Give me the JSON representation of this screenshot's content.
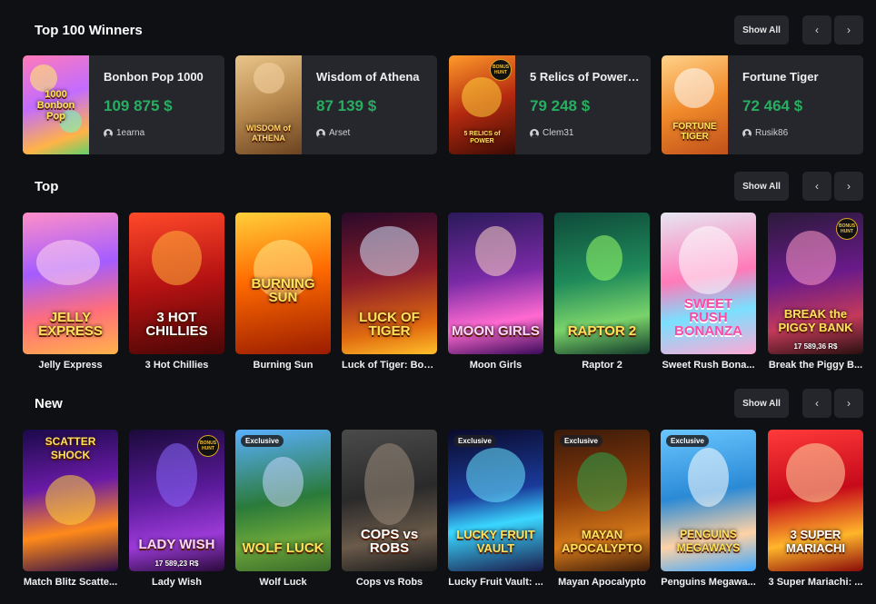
{
  "sections": {
    "winners": {
      "title": "Top 100 Winners",
      "show_all": "Show All"
    },
    "top": {
      "title": "Top",
      "show_all": "Show All"
    },
    "new": {
      "title": "New",
      "show_all": "Show All"
    }
  },
  "nav": {
    "prev_icon": "chevron-left-icon",
    "next_icon": "chevron-right-icon",
    "prev_glyph": "‹",
    "next_glyph": "›"
  },
  "winners": [
    {
      "game": "Bonbon Pop 1000",
      "amount": "109 875 $",
      "user": "1earna",
      "thumb_text": "1000 Bonbon Pop"
    },
    {
      "game": "Wisdom of Athena",
      "amount": "87 139 $",
      "user": "Arset",
      "thumb_text": "WISDOM of ATHENA"
    },
    {
      "game": "5 Relics of Power: ...",
      "amount": "79 248 $",
      "user": "Clem31",
      "thumb_text": "5 RELICS of POWER",
      "hunt": "BONUS HUNT"
    },
    {
      "game": "Fortune Tiger",
      "amount": "72 464 $",
      "user": "Rusik86",
      "thumb_text": "FORTUNE TIGER"
    }
  ],
  "top_games": [
    {
      "name": "Jelly Express",
      "thumb_text": "JELLY EXPRESS"
    },
    {
      "name": "3 Hot Chillies",
      "thumb_text": "3 HOT CHILLIES"
    },
    {
      "name": "Burning Sun",
      "thumb_text": "BURNING SUN"
    },
    {
      "name": "Luck of Tiger: Bon...",
      "thumb_text": "LUCK OF TIGER"
    },
    {
      "name": "Moon Girls",
      "thumb_text": "MOON GIRLS"
    },
    {
      "name": "Raptor 2",
      "thumb_text": "RAPTOR 2"
    },
    {
      "name": "Sweet Rush Bona...",
      "thumb_text": "SWEET RUSH BONANZA"
    },
    {
      "name": "Break the Piggy B...",
      "thumb_text": "BREAK the PIGGY BANK",
      "hunt": "BONUS HUNT",
      "jackpot": "17 589,36 R$"
    }
  ],
  "new_games": [
    {
      "name": "Match Blitz Scatte...",
      "thumb_text": "SCATTER SHOCK"
    },
    {
      "name": "Lady Wish",
      "thumb_text": "LADY WISH",
      "hunt": "BONUS HUNT",
      "jackpot": "17 589,23 R$"
    },
    {
      "name": "Wolf Luck",
      "thumb_text": "WOLF LUCK",
      "badge": "Exclusive"
    },
    {
      "name": "Cops vs Robs",
      "thumb_text": "COPS vs ROBS"
    },
    {
      "name": "Lucky Fruit Vault: ...",
      "thumb_text": "LUCKY FRUIT VAULT",
      "badge": "Exclusive"
    },
    {
      "name": "Mayan Apocalypto",
      "thumb_text": "MAYAN APOCALYPTO",
      "badge": "Exclusive"
    },
    {
      "name": "Penguins Megawa...",
      "thumb_text": "PENGUINS MEGAWAYS",
      "badge": "Exclusive"
    },
    {
      "name": "3 Super Mariachi: ...",
      "thumb_text": "3 SUPER MARIACHI"
    }
  ],
  "colors": {
    "background": "#0f1014",
    "card": "#25272d",
    "button": "#24262c",
    "amount_green": "#27ae60"
  }
}
